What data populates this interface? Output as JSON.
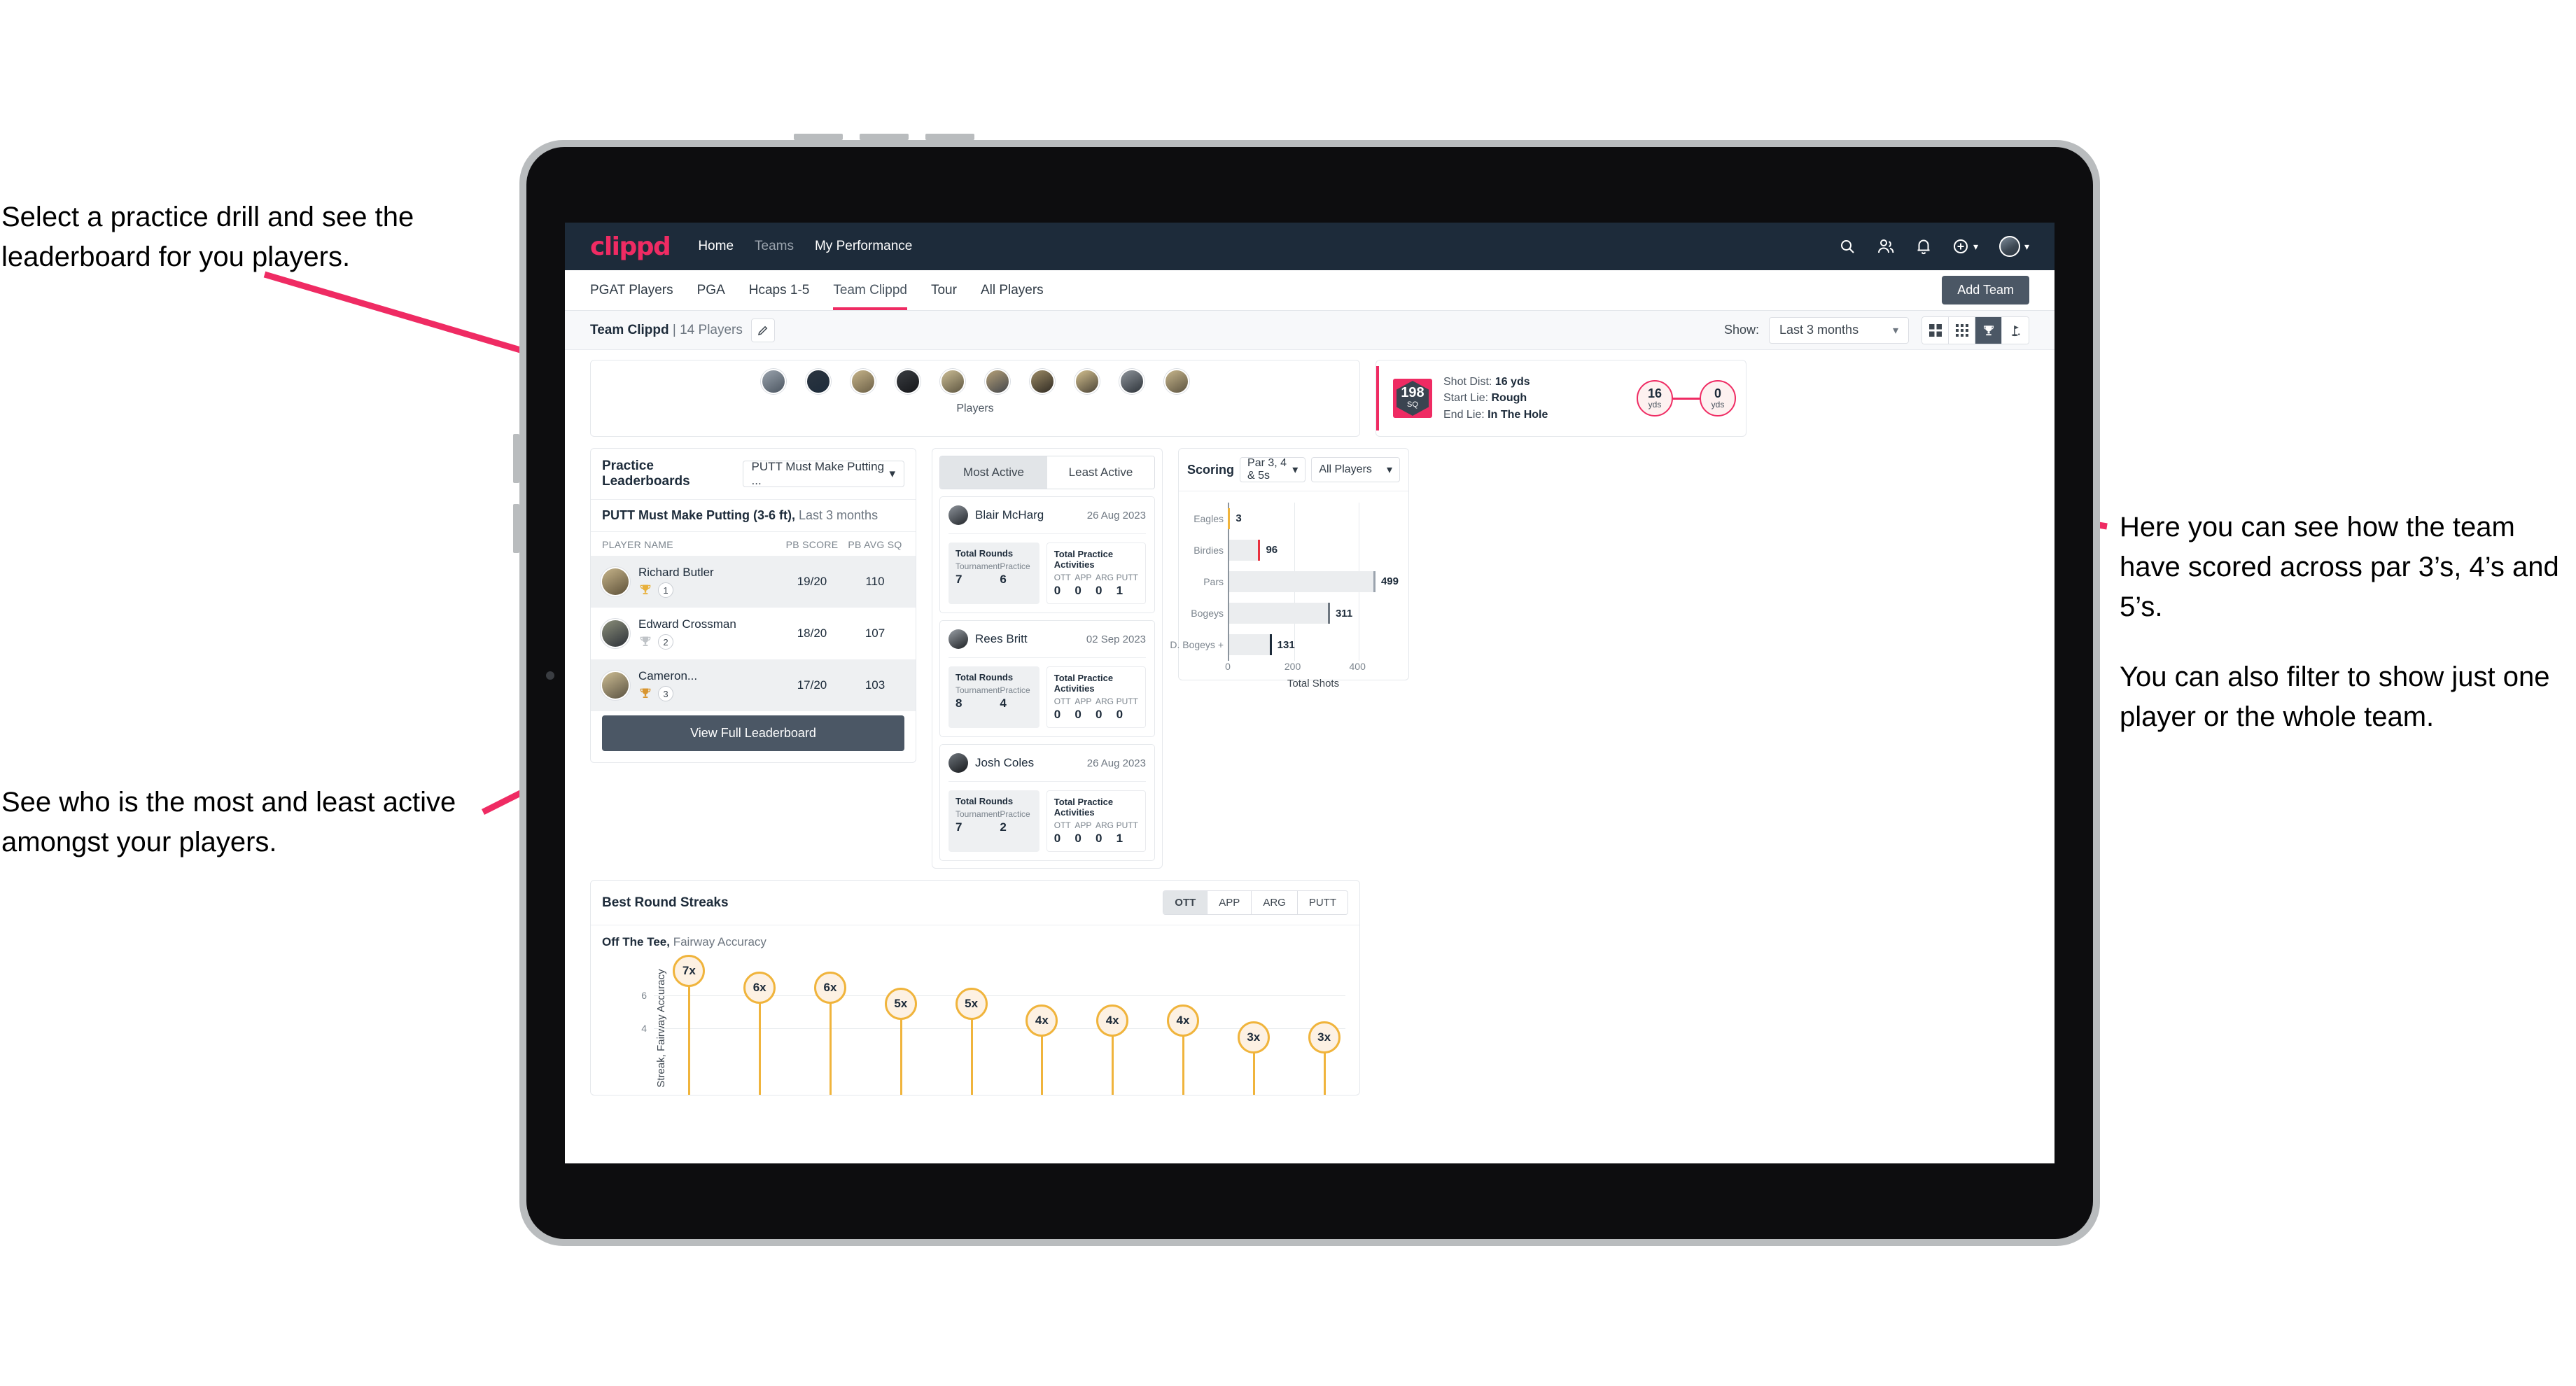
{
  "annotations": {
    "top_left": "Select a practice drill and see the leaderboard for you players.",
    "bottom_left": "See who is the most and least active amongst your players.",
    "right_1": "Here you can see how the team have scored across par 3’s, 4’s and 5’s.",
    "right_2": "You can also filter to show just one player or the whole team."
  },
  "topnav": {
    "brand": "clippd",
    "links": [
      {
        "label": "Home",
        "active": true
      },
      {
        "label": "Teams",
        "active": false
      },
      {
        "label": "My Performance",
        "active": true
      }
    ],
    "icons": [
      "search-icon",
      "people-icon",
      "bell-icon",
      "plus-circle-icon",
      "avatar"
    ]
  },
  "subnav": {
    "tabs": [
      {
        "label": "PGAT Players",
        "active": false
      },
      {
        "label": "PGA",
        "active": false
      },
      {
        "label": "Hcaps 1-5",
        "active": false
      },
      {
        "label": "Team Clippd",
        "active": true
      },
      {
        "label": "Tour",
        "active": false
      },
      {
        "label": "All Players",
        "active": false
      }
    ],
    "add_team_label": "Add Team"
  },
  "toolbar": {
    "team_name": "Team Clippd",
    "team_count": "| 14 Players",
    "edit_icon": "pencil-icon",
    "show_label": "Show:",
    "period_value": "Last 3 months",
    "view_modes": [
      {
        "icon": "grid-large-icon",
        "active": false
      },
      {
        "icon": "grid-small-icon",
        "active": false
      },
      {
        "icon": "trophy-icon",
        "active": true
      },
      {
        "icon": "flag-icon",
        "active": false
      }
    ]
  },
  "players_strip": {
    "caption": "Players",
    "avatar_count": 10
  },
  "shot_card": {
    "sq_value": "198",
    "sq_label": "SQ",
    "rows": [
      {
        "label": "Shot Dist:",
        "value": "16 yds"
      },
      {
        "label": "Start Lie:",
        "value": "Rough"
      },
      {
        "label": "End Lie:",
        "value": "In The Hole"
      }
    ],
    "start_dist": {
      "value": "16",
      "unit": "yds"
    },
    "end_dist": {
      "value": "0",
      "unit": "yds"
    }
  },
  "leaderboard": {
    "title": "Practice Leaderboards",
    "drill_select": "PUTT Must Make Putting ...",
    "subtitle_bold": "PUTT Must Make Putting (3-6 ft),",
    "subtitle_light": " Last 3 months",
    "columns": [
      "PLAYER NAME",
      "PB SCORE",
      "PB AVG SQ"
    ],
    "rows": [
      {
        "name": "Richard Butler",
        "rank": "1",
        "trophy": "gold",
        "pb_score": "19/20",
        "pb_avg_sq": "110",
        "highlighted": true
      },
      {
        "name": "Edward Crossman",
        "rank": "2",
        "trophy": "silver",
        "pb_score": "18/20",
        "pb_avg_sq": "107",
        "highlighted": false
      },
      {
        "name": "Cameron...",
        "rank": "3",
        "trophy": "bronze",
        "pb_score": "17/20",
        "pb_avg_sq": "103",
        "highlighted": true
      }
    ],
    "button_label": "View Full Leaderboard"
  },
  "active_panel": {
    "tabs": [
      {
        "label": "Most Active",
        "active": true
      },
      {
        "label": "Least Active",
        "active": false
      }
    ],
    "rounds_title": "Total Rounds",
    "rounds_cols": [
      "Tournament",
      "Practice"
    ],
    "practice_title": "Total Practice Activities",
    "practice_cols": [
      "OTT",
      "APP",
      "ARG",
      "PUTT"
    ],
    "cards": [
      {
        "name": "Blair McHarg",
        "date": "26 Aug 2023",
        "tournament": "7",
        "practice": "6",
        "ott": "0",
        "app": "0",
        "arg": "0",
        "putt": "1"
      },
      {
        "name": "Rees Britt",
        "date": "02 Sep 2023",
        "tournament": "8",
        "practice": "4",
        "ott": "0",
        "app": "0",
        "arg": "0",
        "putt": "0"
      },
      {
        "name": "Josh Coles",
        "date": "26 Aug 2023",
        "tournament": "7",
        "practice": "2",
        "ott": "0",
        "app": "0",
        "arg": "0",
        "putt": "1"
      }
    ]
  },
  "scoring": {
    "title": "Scoring",
    "par_select": "Par 3, 4 & 5s",
    "player_select": "All Players"
  },
  "streaks": {
    "title": "Best Round Streaks",
    "segments": [
      {
        "label": "OTT",
        "active": true
      },
      {
        "label": "APP",
        "active": false
      },
      {
        "label": "ARG",
        "active": false
      },
      {
        "label": "PUTT",
        "active": false
      }
    ],
    "subtitle_bold": "Off The Tee,",
    "subtitle_light": " Fairway Accuracy"
  },
  "chart_data": [
    {
      "type": "bar",
      "orientation": "horizontal",
      "title": "Scoring",
      "xlabel": "Total Shots",
      "ylabel": "",
      "categories": [
        "Eagles",
        "Birdies",
        "Pars",
        "Bogeys",
        "D. Bogeys +"
      ],
      "values": [
        3,
        96,
        499,
        311,
        131
      ],
      "cap_colors": [
        "#f0b43c",
        "#e8313f",
        "#9aa3ad",
        "#6e7780",
        "#1d2b3a"
      ],
      "xlim": [
        0,
        540
      ],
      "xticks": [
        0,
        200,
        400
      ],
      "grid": true,
      "legend": "none"
    },
    {
      "type": "bar",
      "orientation": "vertical-lollipop",
      "title": "Best Round Streaks",
      "subtitle": "Off The Tee, Fairway Accuracy",
      "ylabel": "Streak, Fairway Accuracy",
      "xlabel": "",
      "values": [
        7,
        6,
        6,
        5,
        5,
        4,
        4,
        4,
        3,
        3
      ],
      "labels": [
        "7x",
        "6x",
        "6x",
        "5x",
        "5x",
        "4x",
        "4x",
        "4x",
        "3x",
        "3x"
      ],
      "yticks": [
        4,
        6
      ],
      "ylim": [
        0,
        8
      ],
      "grid": true,
      "legend": "none"
    }
  ]
}
